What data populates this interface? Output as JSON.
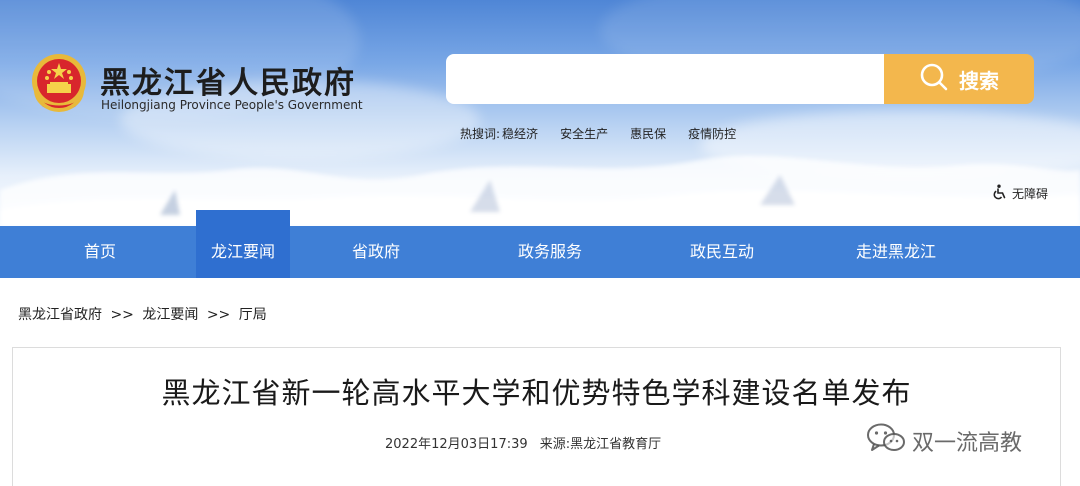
{
  "header": {
    "title": "黑龙江省人民政府",
    "subtitle": "Heilongjiang Province People's Government",
    "emblem_icon": "national-emblem-icon"
  },
  "search": {
    "placeholder": "",
    "button_label": "搜索",
    "button_color": "#f3b74d"
  },
  "hot_words": {
    "label": "热搜词:",
    "items": [
      "稳经济",
      "安全生产",
      "惠民保",
      "疫情防控"
    ]
  },
  "accessibility": {
    "label": "无障碍",
    "icon": "wheelchair-icon"
  },
  "nav": {
    "color": "#3f7fd6",
    "active_color": "#2f6fd0",
    "items": [
      "首页",
      "龙江要闻",
      "省政府",
      "政务服务",
      "政民互动",
      "走进黑龙江"
    ],
    "active_index": 1
  },
  "breadcrumb": {
    "items": [
      "黑龙江省政府",
      "龙江要闻",
      "厅局"
    ],
    "separator": ">>"
  },
  "article": {
    "title": "黑龙江省新一轮高水平大学和优势特色学科建设名单发布",
    "date": "2022年12月03日17:39",
    "source_label": "来源:",
    "source": "黑龙江省教育厅"
  },
  "watermark": {
    "text": "双一流高教",
    "icon": "wechat-icon"
  }
}
